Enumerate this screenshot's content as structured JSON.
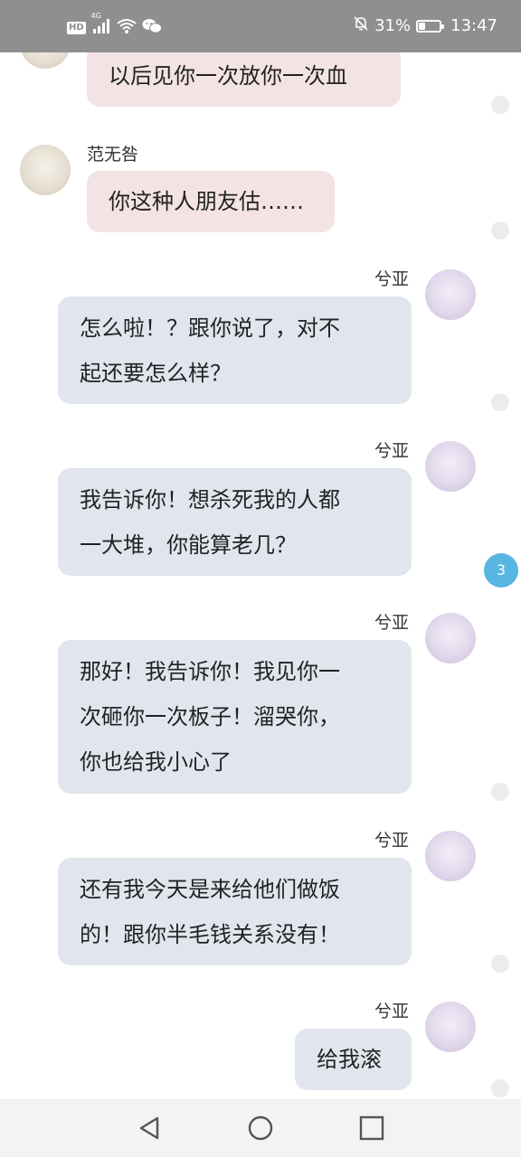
{
  "status_bar": {
    "network_badge": "HD",
    "network_type": "4G",
    "battery_percent": "31%",
    "battery_level": 0.31,
    "time": "13:47",
    "icons": [
      "signal-icon",
      "wifi-icon",
      "wechat-icon",
      "mute-bell-icon",
      "battery-icon"
    ]
  },
  "messages": [
    {
      "side": "left",
      "name": "",
      "text": "以后见你一次放你一次血"
    },
    {
      "side": "left",
      "name": "范无咎",
      "text": "你这种人朋友估……"
    },
    {
      "side": "right",
      "name": "兮亚",
      "lines": [
        "怎么啦！？跟你说了，对不",
        "起还要怎么样？"
      ]
    },
    {
      "side": "right",
      "name": "兮亚",
      "lines": [
        "我告诉你！想杀死我的人都",
        "一大堆，你能算老几？"
      ]
    },
    {
      "side": "right",
      "name": "兮亚",
      "lines": [
        "那好！我告诉你！我见你一",
        "次砸你一次板子！溜哭你，",
        "你也给我小心了"
      ]
    },
    {
      "side": "right",
      "name": "兮亚",
      "lines": [
        "还有我今天是来给他们做饭",
        "的！跟你半毛钱关系没有！"
      ]
    },
    {
      "side": "right",
      "name": "兮亚",
      "text": "给我滚"
    }
  ],
  "unread_badge": "3",
  "nav": {
    "icons": [
      "back-triangle-icon",
      "home-circle-icon",
      "recents-square-icon"
    ]
  }
}
